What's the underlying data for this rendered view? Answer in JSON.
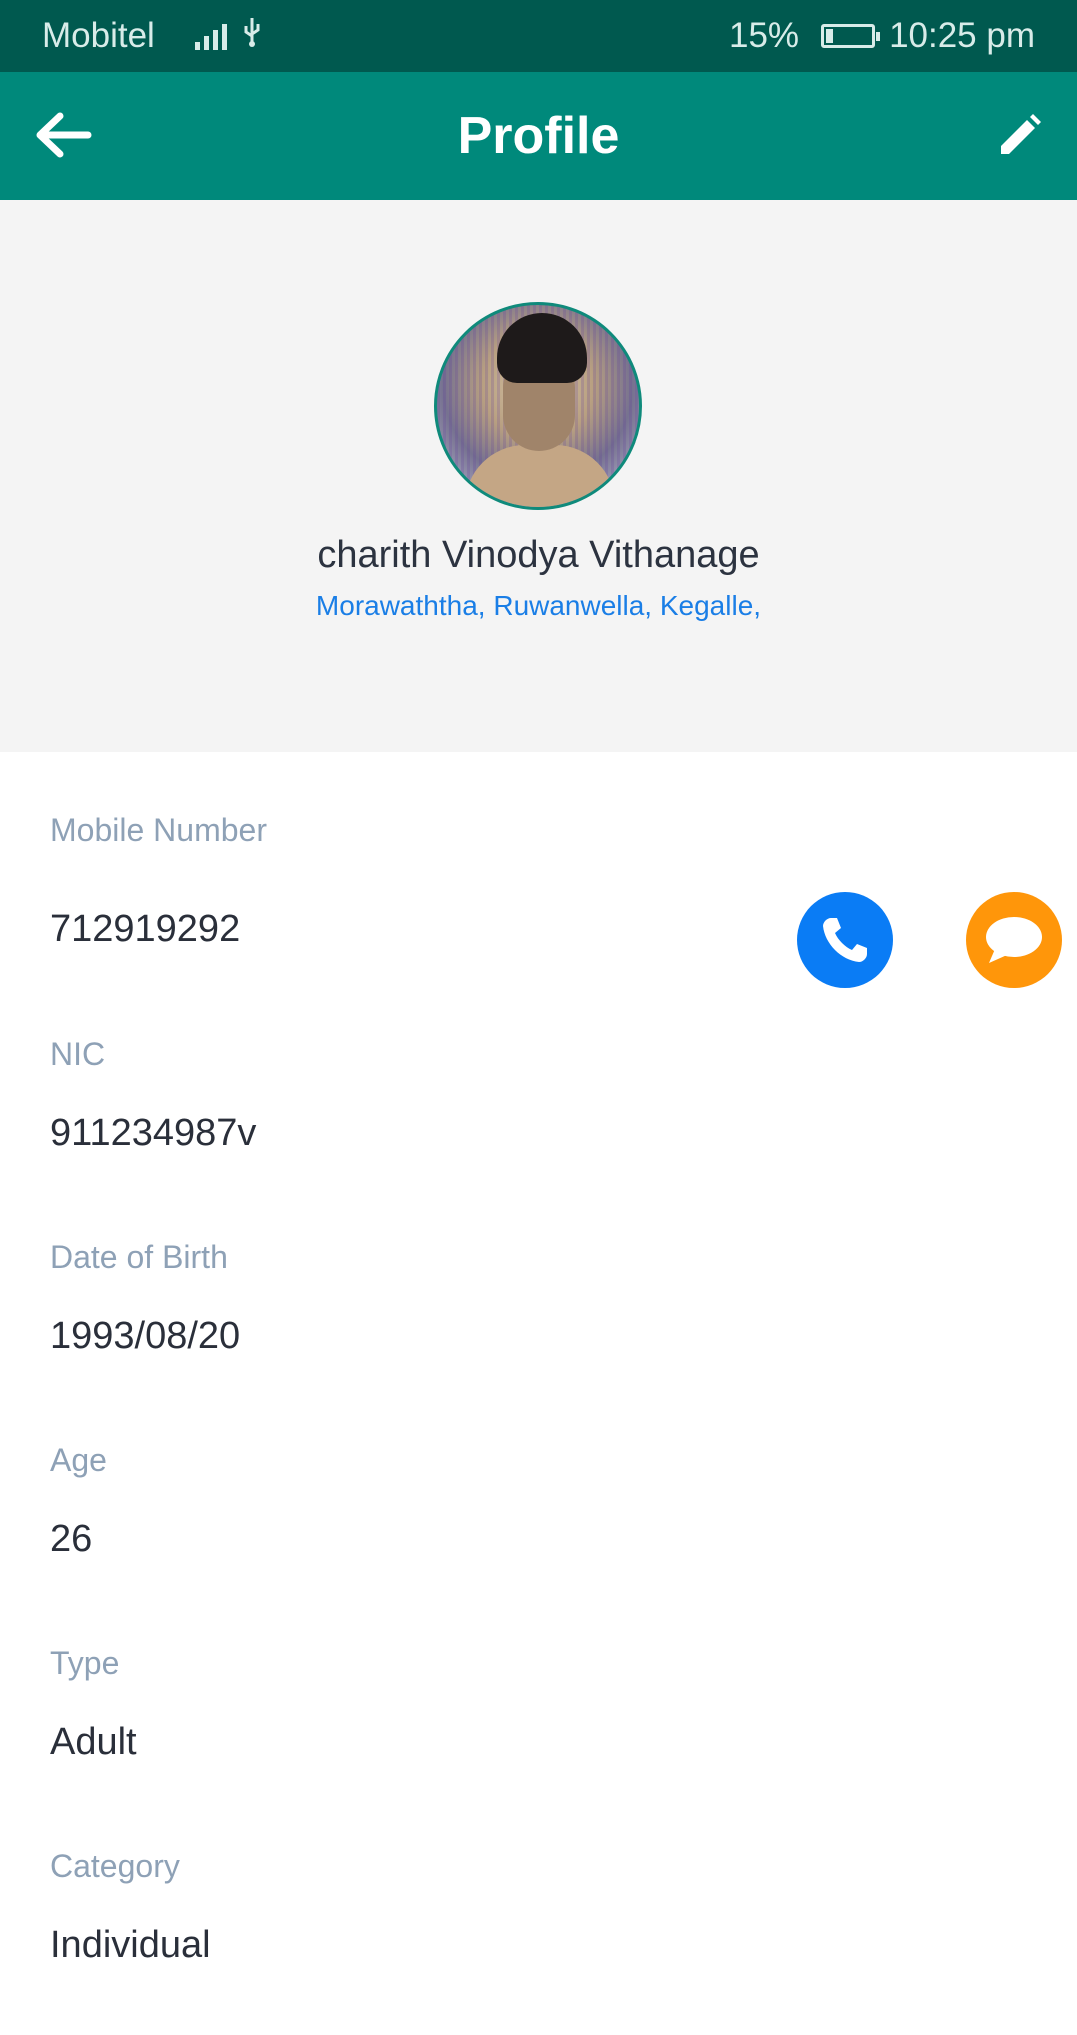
{
  "status_bar": {
    "carrier": "Mobitel",
    "battery": "15%",
    "battery_level": 0.15,
    "time": "10:25 pm",
    "icons": [
      "signal-icon",
      "usb-icon",
      "battery-charging-icon"
    ]
  },
  "app_bar": {
    "title": "Profile",
    "back_icon": "arrow-left-icon",
    "edit_icon": "pencil-icon"
  },
  "profile": {
    "name": "charith Vinodya Vithanage",
    "address": "Morawaththa, Ruwanwella, Kegalle,"
  },
  "fields": {
    "mobile": {
      "label": "Mobile Number",
      "value": "712919292"
    },
    "nic": {
      "label": "NIC",
      "value": "911234987v"
    },
    "dob": {
      "label": "Date of Birth",
      "value": "1993/08/20"
    },
    "age": {
      "label": "Age",
      "value": "26"
    },
    "type": {
      "label": "Type",
      "value": "Adult"
    },
    "category": {
      "label": "Category",
      "value": "Individual"
    }
  },
  "actions": {
    "call_icon": "phone-icon",
    "message_icon": "chat-bubble-icon"
  },
  "colors": {
    "status_bar": "#00594f",
    "app_bar": "#00897b",
    "header_bg": "#f4f4f4",
    "address_link": "#1a7ee6",
    "label": "#8ea1b6",
    "value": "#2a2f3a",
    "call_button": "#0a7cf5",
    "message_button": "#ff960a"
  }
}
